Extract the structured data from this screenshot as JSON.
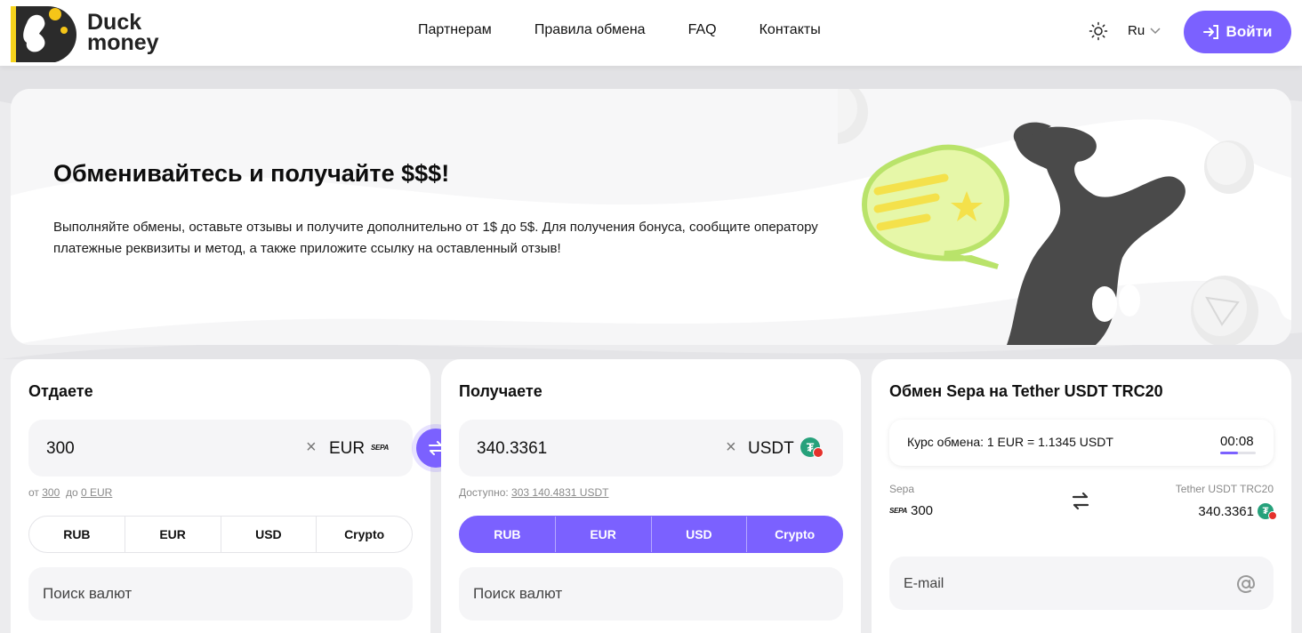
{
  "header": {
    "logo_line1": "Duck",
    "logo_line2": "money",
    "nav": [
      "Партнерам",
      "Правила обмена",
      "FAQ",
      "Контакты"
    ],
    "lang": "Ru",
    "login_label": "Войти"
  },
  "banner": {
    "title": "Обменивайтесь и получайте $$$!",
    "text": "Выполняйте обмены, оставьте отзывы и получите дополнительно от 1$ до 5$. Для получения бонуса, сообщите оператору платежные реквизиты и метод, а также приложите ссылку на оставленный отзыв!"
  },
  "give": {
    "title": "Отдаете",
    "amount": "300",
    "currency": "EUR",
    "method_badge": "SEPA",
    "limits_prefix": "от",
    "limits_min": "300",
    "limits_mid": "до",
    "limits_max": "0 EUR",
    "tabs": [
      "RUB",
      "EUR",
      "USD",
      "Crypto"
    ],
    "search_placeholder": "Поиск валют"
  },
  "receive": {
    "title": "Получаете",
    "amount": "340.3361",
    "currency": "USDT",
    "available_label": "Доступно:",
    "available_value": "303 140.4831 USDT",
    "tabs": [
      "RUB",
      "EUR",
      "USD",
      "Crypto"
    ],
    "search_placeholder": "Поиск валют"
  },
  "summary": {
    "title": "Обмен Sepa на Tether USDT TRC20",
    "rate_text": "Курс обмена: 1 EUR = 1.1345 USDT",
    "timer": "00:08",
    "timer_progress": 0.5,
    "from_label": "Sepa",
    "from_badge": "SEPA",
    "from_value": "300",
    "to_label": "Tether USDT TRC20",
    "to_value": "340.3361",
    "email_placeholder": "E-mail"
  },
  "colors": {
    "accent": "#7b61ff",
    "tether": "#26a17b",
    "tron": "#e5312c"
  },
  "icons": [
    "duck-logo-icon",
    "sun-icon",
    "chevron-down-icon",
    "login-icon",
    "close-icon",
    "swap-icon",
    "swap-arrows-icon",
    "at-icon",
    "tether-icon",
    "sepa-icon"
  ]
}
